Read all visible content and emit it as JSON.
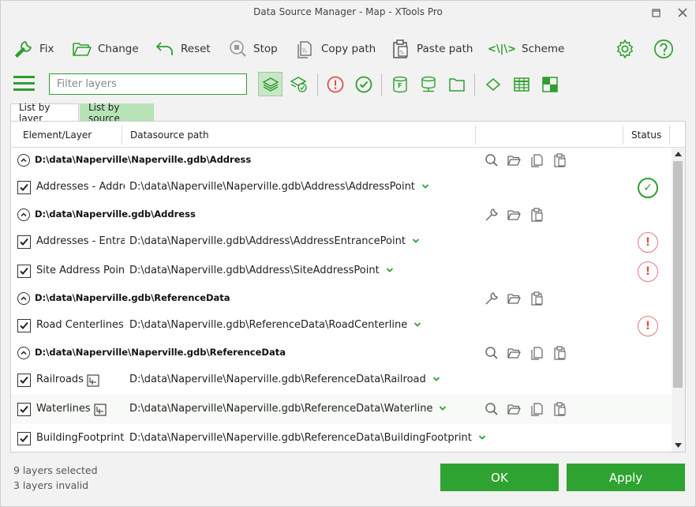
{
  "window": {
    "title": "Data Source Manager - Map  -  XTools Pro"
  },
  "toolbar": {
    "fix": "Fix",
    "change": "Change",
    "reset": "Reset",
    "stop": "Stop",
    "copy_path": "Copy path",
    "paste_path": "Paste path",
    "scheme_glyph": "<\\|\\>",
    "scheme": "Scheme"
  },
  "filter": {
    "placeholder": "Filter layers"
  },
  "tabs": [
    "List by layer",
    "List by source"
  ],
  "columns": {
    "element": "Element/Layer",
    "datasource": "Datasource path",
    "status": "Status"
  },
  "groups": [
    {
      "path": "D:\\data\\Naperville\\Naperville.gdb\\Address",
      "items": [
        {
          "layer": "Addresses - Address Points",
          "path": "D:\\data\\Naperville\\Naperville.gdb\\Address\\AddressPoint",
          "status": "ok"
        }
      ]
    },
    {
      "path": "D:\\data\\Naperville.gdb\\Address",
      "items": [
        {
          "layer": "Addresses - Entrance Points",
          "path": "D:\\data\\Naperville.gdb\\Address\\AddressEntrancePoint",
          "status": "error"
        },
        {
          "layer": "Site Address Points",
          "path": "D:\\data\\Naperville.gdb\\Address\\SiteAddressPoint",
          "status": "error"
        }
      ]
    },
    {
      "path": "D:\\data\\Naperville.gdb\\ReferenceData",
      "items": [
        {
          "layer": "Road Centerlines",
          "path": "D:\\data\\Naperville.gdb\\ReferenceData\\RoadCenterline",
          "status": "error"
        }
      ]
    },
    {
      "path": "D:\\data\\Naperville\\Naperville.gdb\\ReferenceData",
      "items": [
        {
          "layer": "Railroads",
          "path": "D:\\data\\Naperville\\Naperville.gdb\\ReferenceData\\Railroad",
          "status": ""
        },
        {
          "layer": "Waterlines",
          "path": "D:\\data\\Naperville\\Naperville.gdb\\ReferenceData\\Waterline",
          "status": ""
        },
        {
          "layer": "BuildingFootprint",
          "path": "D:\\data\\Naperville\\Naperville.gdb\\ReferenceData\\BuildingFootprint",
          "status": ""
        }
      ]
    }
  ],
  "status_glyphs": {
    "ok": "✓",
    "error": "!"
  },
  "footer": {
    "selected": "9 layers selected",
    "invalid": "3 layers invalid",
    "ok": "OK",
    "apply": "Apply"
  },
  "colors": {
    "accent": "#2f9e2f",
    "error": "#d9534f",
    "tab_active": "#b7e3b7",
    "button": "#2fa331"
  }
}
